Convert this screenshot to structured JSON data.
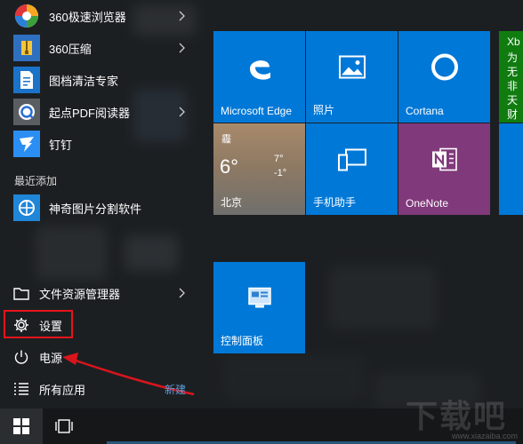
{
  "apps": [
    {
      "label": "360极速浏览器",
      "icon": "360-browser-icon",
      "has_submenu": true
    },
    {
      "label": "360压缩",
      "icon": "360-zip-icon",
      "has_submenu": true
    },
    {
      "label": "图档清洁专家",
      "icon": "doc-cleaner-icon",
      "has_submenu": false
    },
    {
      "label": "起点PDF阅读器",
      "icon": "pdf-reader-icon",
      "has_submenu": true
    },
    {
      "label": "钉钉",
      "icon": "dingtalk-icon",
      "has_submenu": false
    }
  ],
  "recent_section_label": "最近添加",
  "recent_apps": [
    {
      "label": "神奇图片分割软件",
      "icon": "image-splitter-icon"
    }
  ],
  "system": {
    "explorer_label": "文件资源管理器",
    "settings_label": "设置",
    "power_label": "电源",
    "all_apps_label": "所有应用"
  },
  "annotation": {
    "new_label": "新建",
    "highlight_color": "#e8141b"
  },
  "tiles": {
    "edge": {
      "label": "Microsoft Edge"
    },
    "photos": {
      "label": "照片"
    },
    "cortana": {
      "label": "Cortana"
    },
    "weather": {
      "condition": "霾",
      "temp": "6°",
      "high": "7°",
      "low": "-1°",
      "city": "北京"
    },
    "phone": {
      "label": "手机助手"
    },
    "onenote": {
      "label": "OneNote"
    },
    "control_panel": {
      "label": "控制面板"
    }
  },
  "side_tiles": {
    "top": "Xb",
    "lines": [
      "为",
      "无",
      "非",
      "天",
      "财"
    ]
  },
  "watermark": {
    "text": "下载吧",
    "url": "www.xiazaiba.com"
  },
  "colors": {
    "tile_blue": "#0078d7",
    "onenote_purple": "#80397b",
    "accent_arrow": "#d9151c"
  }
}
